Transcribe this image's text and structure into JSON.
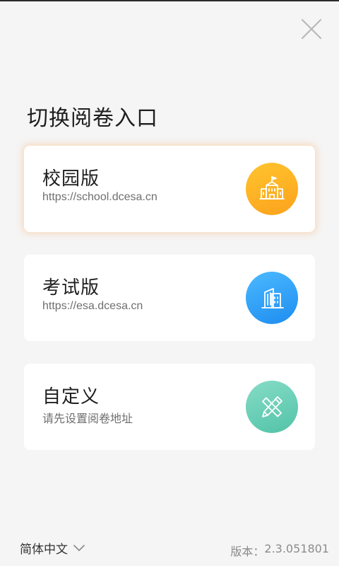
{
  "header": {
    "title": "切换阅卷入口",
    "close_icon": "close-icon"
  },
  "entries": [
    {
      "title": "校园版",
      "url": "https://school.dcesa.cn",
      "icon": "school-building-icon",
      "icon_color": "#fcb020",
      "selected": true
    },
    {
      "title": "考试版",
      "url": "https://esa.dcesa.cn",
      "icon": "office-building-icon",
      "icon_color": "#2a9cf7",
      "selected": false
    },
    {
      "title": "自定义",
      "url": "请先设置阅卷地址",
      "icon": "pencil-ruler-icon",
      "icon_color": "#5cc9ad",
      "selected": false
    }
  ],
  "footer": {
    "language": "简体中文",
    "version_label": "版本：",
    "version_value": "2.3.051801"
  }
}
